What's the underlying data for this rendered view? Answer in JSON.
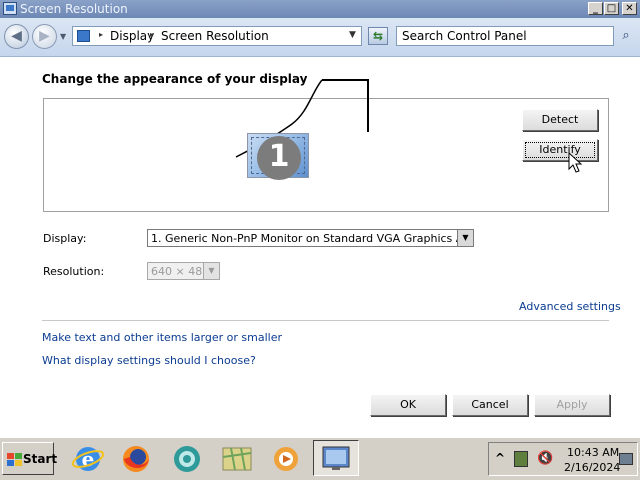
{
  "window": {
    "title": "Screen Resolution",
    "controls": {
      "minimize": "_",
      "maximize": "□",
      "close": "✕"
    }
  },
  "address_bar": {
    "back_icon": "back-arrow-icon",
    "forward_icon": "forward-arrow-icon",
    "breadcrumb": [
      "Display",
      "Screen Resolution"
    ],
    "search_placeholder": "Search Control Panel"
  },
  "main": {
    "heading": "Change the appearance of your display",
    "monitor_number": "1",
    "detect_label": "Detect",
    "identify_label": "Identify",
    "display_label": "Display:",
    "display_value": "1. Generic Non-PnP Monitor on Standard VGA Graphics Adapter",
    "resolution_label": "Resolution:",
    "resolution_value": "640 × 480",
    "advanced_link": "Advanced settings",
    "link_larger": "Make text and other items larger or smaller",
    "link_choose": "What display settings should I choose?",
    "ok_label": "OK",
    "cancel_label": "Cancel",
    "apply_label": "Apply"
  },
  "taskbar": {
    "start_label": "Start",
    "apps": [
      "internet-explorer-icon",
      "firefox-icon",
      "browser-icon",
      "maps-icon",
      "media-player-icon",
      "display-settings-icon"
    ],
    "clock_time": "10:43 AM",
    "clock_date": "2/16/2024"
  },
  "colors": {
    "link": "#0b3c91",
    "titlebar": "#6d87b5",
    "taskbar": "#d4d0c8"
  }
}
